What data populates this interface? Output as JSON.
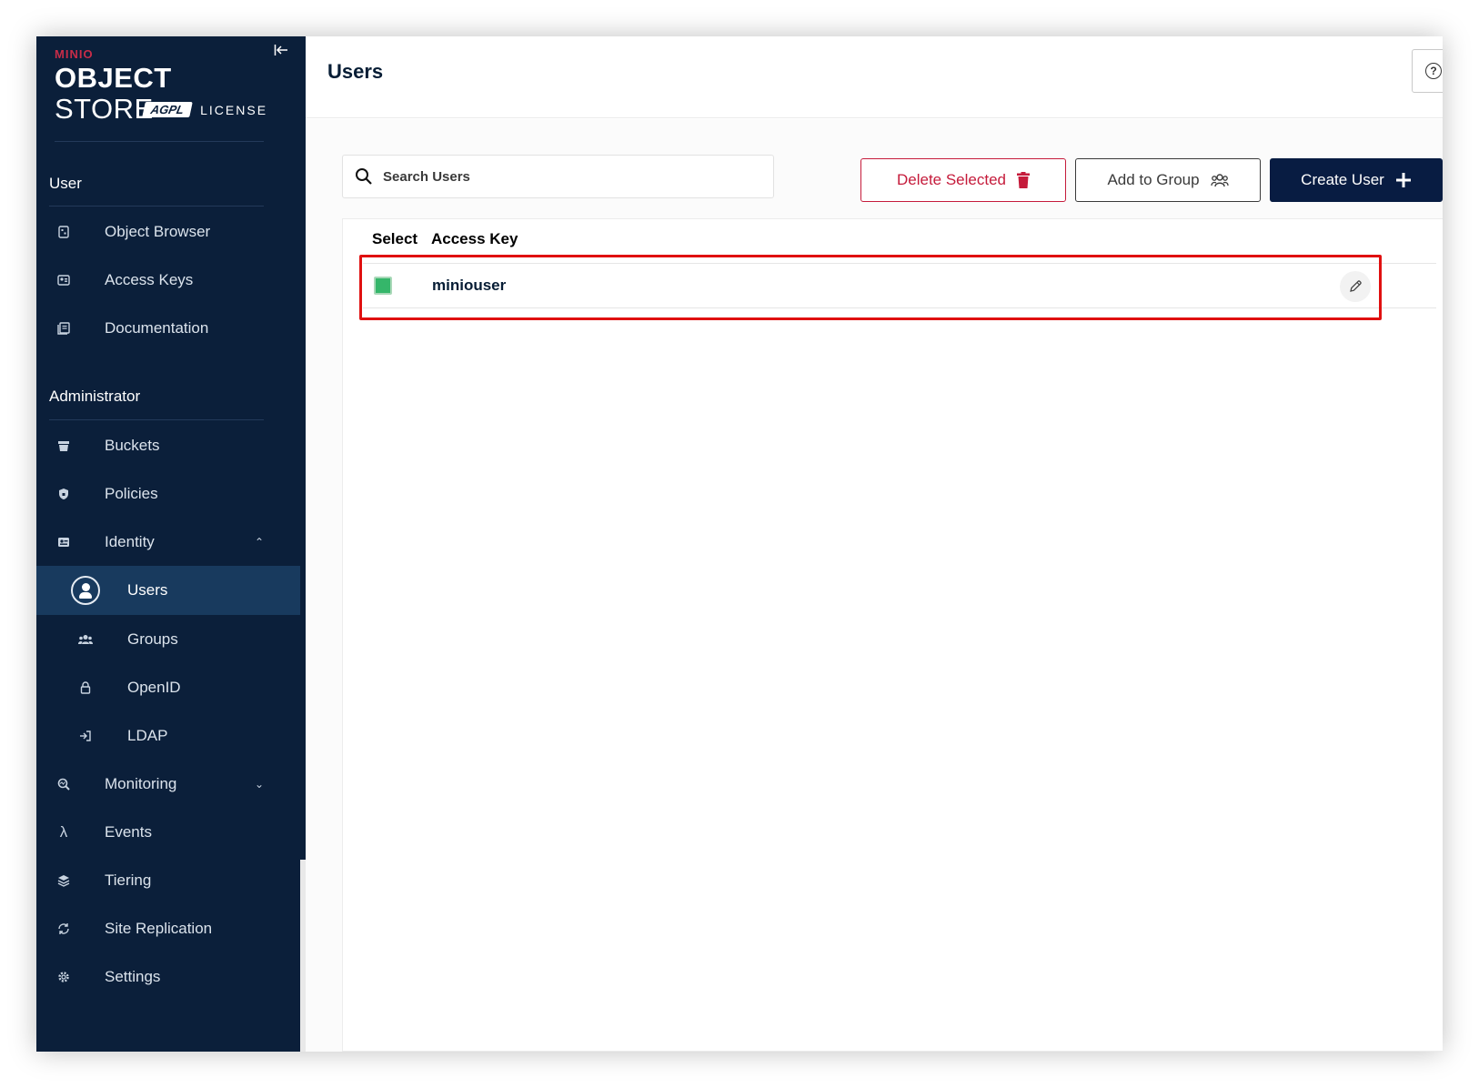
{
  "app": {
    "brand_top": "MINIO",
    "brand_main_bold": "OBJECT",
    "brand_main_light": " STORE",
    "license_badge": "AGPL",
    "license_text": "LICENSE"
  },
  "sidebar": {
    "sections": [
      {
        "title": "User"
      },
      {
        "title": "Administrator"
      }
    ],
    "user_items": [
      {
        "label": "Object Browser",
        "icon": "object-browser-icon"
      },
      {
        "label": "Access Keys",
        "icon": "access-keys-icon"
      },
      {
        "label": "Documentation",
        "icon": "documentation-icon"
      }
    ],
    "admin_items": [
      {
        "label": "Buckets",
        "icon": "bucket-icon"
      },
      {
        "label": "Policies",
        "icon": "policy-shield-icon"
      },
      {
        "label": "Identity",
        "icon": "identity-icon",
        "expanded": true
      },
      {
        "label": "Users",
        "icon": "user-circle-icon",
        "active": true
      },
      {
        "label": "Groups",
        "icon": "groups-icon"
      },
      {
        "label": "OpenID",
        "icon": "lock-icon"
      },
      {
        "label": "LDAP",
        "icon": "login-icon"
      },
      {
        "label": "Monitoring",
        "icon": "monitoring-icon",
        "expanded": false
      },
      {
        "label": "Events",
        "icon": "lambda-icon"
      },
      {
        "label": "Tiering",
        "icon": "tiers-icon"
      },
      {
        "label": "Site Replication",
        "icon": "replication-icon"
      },
      {
        "label": "Settings",
        "icon": "gear-icon"
      }
    ]
  },
  "header": {
    "title": "Users",
    "help_glyph": "?"
  },
  "toolbar": {
    "search_placeholder": "Search Users",
    "search_value": "",
    "delete_label": "Delete Selected",
    "add_group_label": "Add to Group",
    "create_label": "Create User"
  },
  "table": {
    "columns": [
      "Select",
      "Access Key"
    ],
    "rows": [
      {
        "access_key": "miniouser",
        "selected": true
      }
    ]
  },
  "colors": {
    "sidebar_bg": "#0b1f3a",
    "active_item": "#183a5e",
    "danger": "#c51b3b",
    "primary_btn": "#081c42",
    "checkbox": "#35b66a",
    "highlight": "#e01010"
  }
}
